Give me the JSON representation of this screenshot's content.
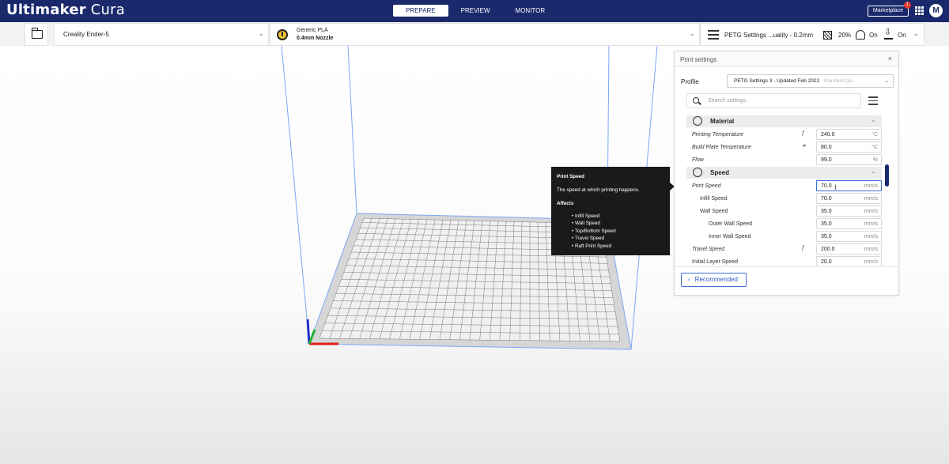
{
  "header": {
    "brand_bold": "Ultimaker",
    "brand_rest": " Cura",
    "tabs": [
      {
        "label": "PREPARE",
        "active": true
      },
      {
        "label": "PREVIEW",
        "active": false
      },
      {
        "label": "MONITOR",
        "active": false
      }
    ],
    "marketplace_label": "Marketplace",
    "notification_count": "1",
    "avatar_initial": "M"
  },
  "toolbar": {
    "printer": "Creality Ender-5",
    "material_name": "Generic PLA",
    "nozzle": "0.4mm Nozzle",
    "settings_label": "PETG Settings ...uality - 0.2mm",
    "infill": "20%",
    "support": "On",
    "adhesion": "On"
  },
  "panel": {
    "title": "Print settings",
    "close_glyph": "×",
    "profile_label": "Profile",
    "profile_value": "PETG Settings 3 - Updated Feb 2023",
    "profile_sub": "Standard Qu...",
    "search_placeholder": "Search settings",
    "categories": {
      "material": "Material",
      "speed": "Speed"
    },
    "material_rows": [
      {
        "label": "Printing Temperature",
        "value": "240.0",
        "unit": "°C",
        "mark": "f(x)"
      },
      {
        "label": "Build Plate Temperature",
        "value": "80.0",
        "unit": "°C",
        "mark": "link"
      },
      {
        "label": "Flow",
        "value": "99.0",
        "unit": "%",
        "mark": ""
      }
    ],
    "speed_rows": [
      {
        "label": "Print Speed",
        "value": "70.0",
        "unit": "mm/s"
      },
      {
        "label": "Infill Speed",
        "value": "70.0",
        "unit": "mm/s"
      },
      {
        "label": "Wall Speed",
        "value": "35.0",
        "unit": "mm/s"
      },
      {
        "label": "Outer Wall Speed",
        "value": "35.0",
        "unit": "mm/s"
      },
      {
        "label": "Inner Wall Speed",
        "value": "35.0",
        "unit": "mm/s"
      },
      {
        "label": "Travel Speed",
        "value": "200.0",
        "unit": "mm/s"
      },
      {
        "label": "Initial Layer Speed",
        "value": "20.0",
        "unit": "mm/s"
      }
    ],
    "recommended_label": "Recommended"
  },
  "tooltip": {
    "title": "Print Speed",
    "description": "The speed at which printing happens.",
    "affects_label": "Affects",
    "affects": [
      "• Infill Speed",
      "• Wall Speed",
      "• Top/Bottom Speed",
      "• Travel Speed",
      "• Raft Print Speed"
    ]
  },
  "colors": {
    "header_bg": "#19296b",
    "accent": "#3b6fd8",
    "build_volume_line": "#7aa7f5"
  }
}
